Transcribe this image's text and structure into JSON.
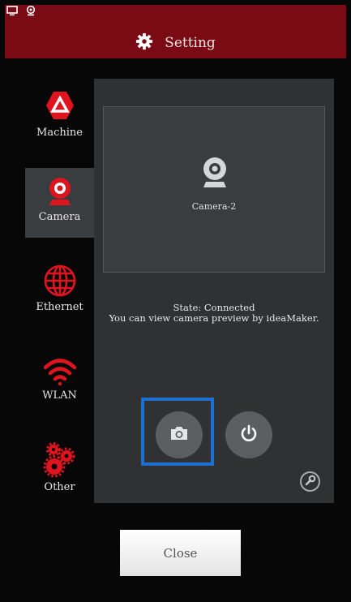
{
  "header": {
    "title": "Setting"
  },
  "status_icons": [
    "monitor-icon",
    "webcam-icon"
  ],
  "sidebar": {
    "items": [
      {
        "label": "Machine",
        "icon": "machine-logo-icon",
        "active": false
      },
      {
        "label": "Camera",
        "icon": "webcam-icon",
        "active": true
      },
      {
        "label": "Ethernet",
        "icon": "globe-icon",
        "active": false
      },
      {
        "label": "WLAN",
        "icon": "wifi-icon",
        "active": false
      },
      {
        "label": "Other",
        "icon": "gears-icon",
        "active": false
      }
    ]
  },
  "camera": {
    "name": "Camera-2",
    "state_line1": "State: Connected",
    "state_line2": "You can view camera preview by ideaMaker."
  },
  "actions": {
    "snapshot_icon": "camera-icon",
    "power_icon": "power-icon",
    "wrench_icon": "wrench-icon"
  },
  "footer": {
    "close_label": "Close"
  },
  "colors": {
    "header_bg": "#7a0a13",
    "accent_red": "#e0141e",
    "panel_bg": "#2f3133",
    "highlight_blue": "#1a6fd1"
  }
}
